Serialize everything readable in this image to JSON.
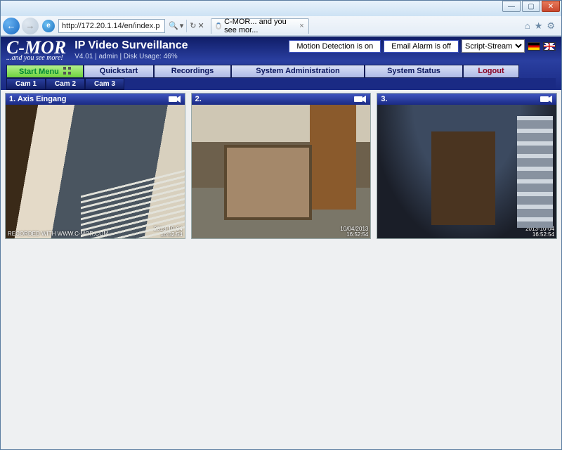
{
  "browser": {
    "url": "http://172.20.1.14/en/index.p",
    "tab_title": "C-MOR... and you see mor...",
    "search_glyph": "🔍",
    "refresh_glyph": "↻",
    "stop_glyph": "✕",
    "back_glyph": "←",
    "fwd_glyph": "→",
    "min_glyph": "—",
    "max_glyph": "▢",
    "close_glyph": "✕",
    "home_glyph": "⌂",
    "star_glyph": "★",
    "gear_glyph": "⚙"
  },
  "app": {
    "logo_text": "C-MOR",
    "tagline": "...and you see more!",
    "title": "IP Video Surveillance",
    "version_line": "V4.01 | admin | Disk Usage: 46%",
    "status_motion": "Motion Detection is on",
    "status_email": "Email Alarm is off",
    "stream_select": "Script-Stream"
  },
  "menu": {
    "start": "Start Menu",
    "quickstart": "Quickstart",
    "recordings": "Recordings",
    "sysadmin": "System Administration",
    "sysstatus": "System Status",
    "logout": "Logout"
  },
  "camtabs": [
    "Cam 1",
    "Cam 2",
    "Cam 3"
  ],
  "cams": [
    {
      "title": "1. Axis Eingang",
      "date": "2013-10-04",
      "time": "16:52:54",
      "watermark": "RECORDED WITH WWW.C-MOR.COM"
    },
    {
      "title": "2.",
      "date": "10/04/2013",
      "time": "16:52:54",
      "watermark": ""
    },
    {
      "title": "3.",
      "date": "2013-10-04",
      "time": "16:52:54",
      "watermark": ""
    }
  ]
}
